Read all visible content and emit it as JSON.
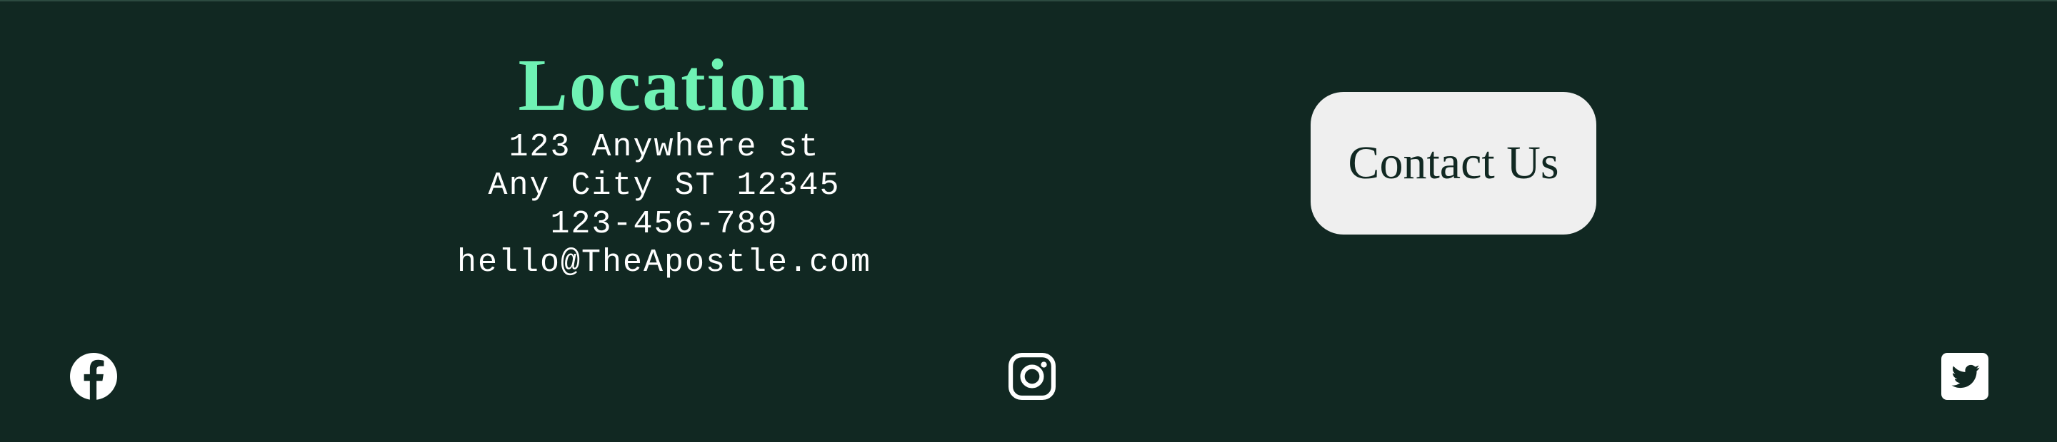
{
  "location": {
    "title": "Location",
    "address_lines": [
      "123 Anywhere st",
      "Any City ST 12345",
      "123-456-789",
      "hello@TheApostle.com"
    ]
  },
  "contact": {
    "button_label": "Contact Us"
  },
  "social": {
    "items": [
      {
        "icon": "facebook-icon"
      },
      {
        "icon": "instagram-icon"
      },
      {
        "icon": "twitter-icon"
      }
    ]
  },
  "colors": {
    "background": "#112822",
    "accent": "#6ff2b4",
    "text": "#ffffff",
    "button_bg": "#efefef",
    "button_text": "#112822"
  }
}
